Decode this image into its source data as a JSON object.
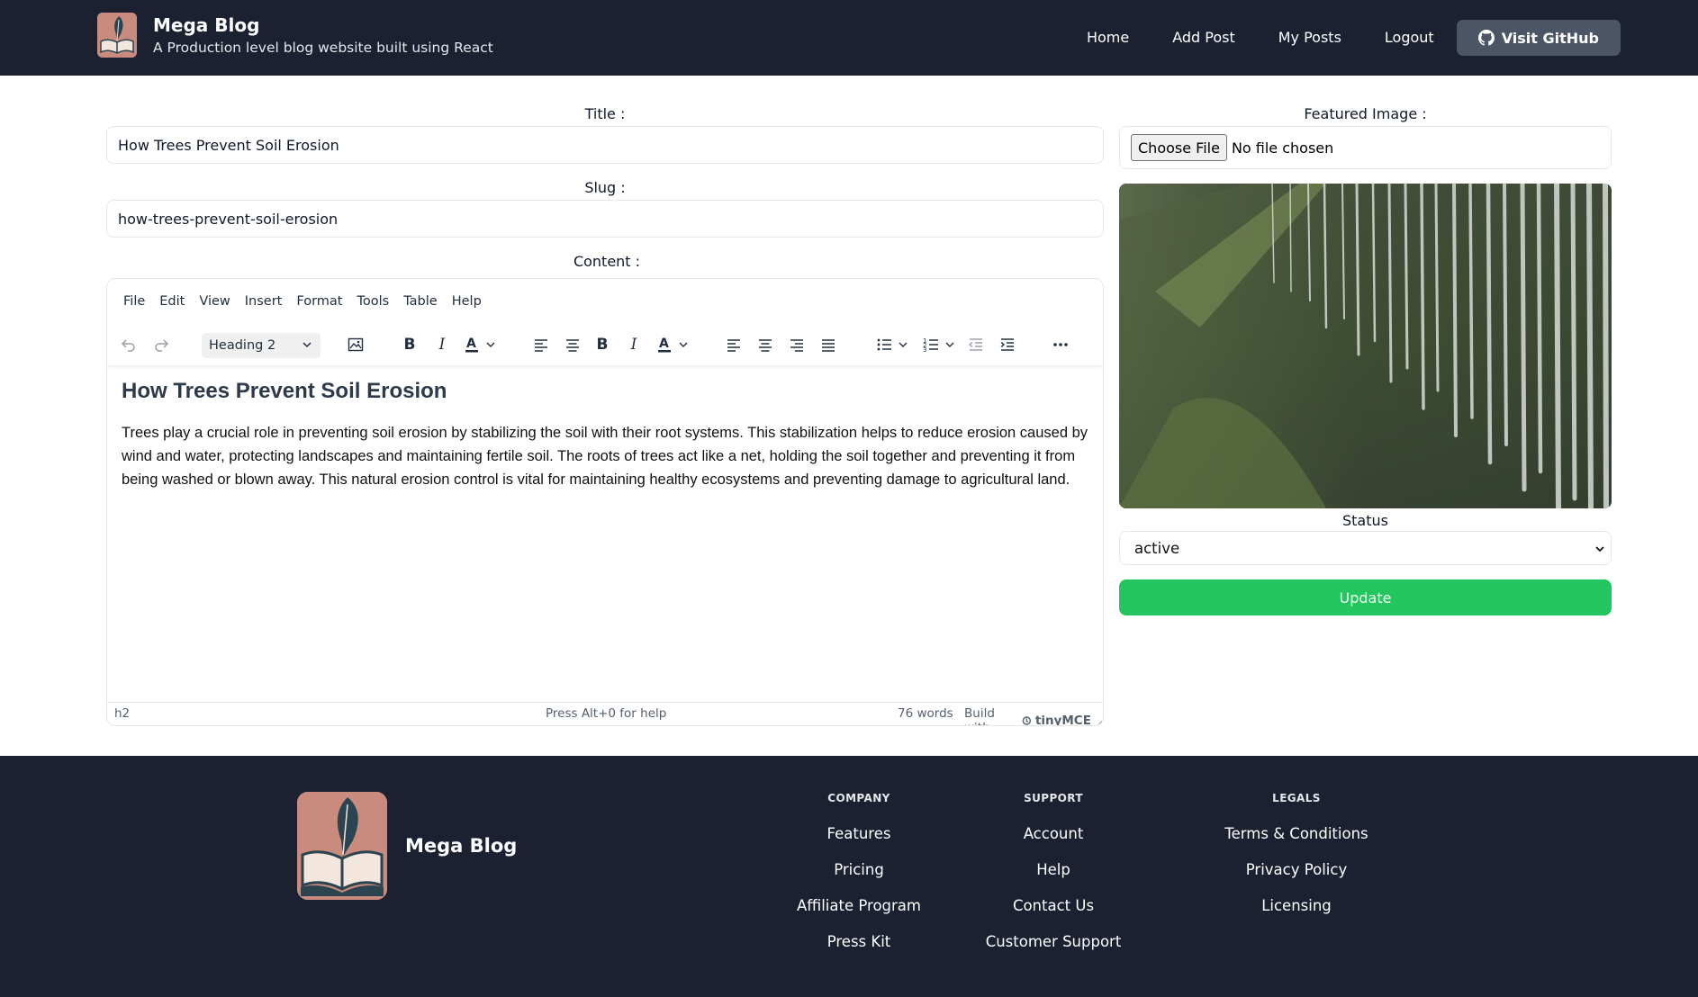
{
  "header": {
    "title": "Mega Blog",
    "subtitle": "A Production level blog website built using React",
    "nav": [
      "Home",
      "Add Post",
      "My Posts",
      "Logout"
    ],
    "github_label": "Visit GitHub"
  },
  "form": {
    "title_label": "Title :",
    "title_value": "How Trees Prevent Soil Erosion",
    "slug_label": "Slug :",
    "slug_value": "how-trees-prevent-soil-erosion",
    "content_label": "Content :",
    "featured_label": "Featured Image :",
    "choose_file": "Choose File",
    "file_status": "No file chosen",
    "status_label": "Status",
    "status_value": "active",
    "update_label": "Update"
  },
  "editor": {
    "menus": [
      "File",
      "Edit",
      "View",
      "Insert",
      "Format",
      "Tools",
      "Table",
      "Help"
    ],
    "block_format": "Heading 2",
    "heading": "How Trees Prevent Soil Erosion",
    "paragraph": "Trees play a crucial role in preventing soil erosion by stabilizing the soil with their root systems. This stabilization helps to reduce erosion caused by wind and water, protecting landscapes and maintaining fertile soil. The roots of trees act like a net, holding the soil together and preventing it from being washed or blown away. This natural erosion control is vital for maintaining healthy ecosystems and preventing damage to agricultural land.",
    "path": "h2",
    "help": "Press Alt+0 for help",
    "word_count": "76 words",
    "build_with": "Build with",
    "brand": "tinyMCE"
  },
  "footer": {
    "title": "Mega Blog",
    "columns": [
      {
        "heading": "COMPANY",
        "links": [
          "Features",
          "Pricing",
          "Affiliate Program",
          "Press Kit"
        ]
      },
      {
        "heading": "SUPPORT",
        "links": [
          "Account",
          "Help",
          "Contact Us",
          "Customer Support"
        ]
      },
      {
        "heading": "LEGALS",
        "links": [
          "Terms & Conditions",
          "Privacy Policy",
          "Licensing"
        ]
      }
    ]
  },
  "colors": {
    "header_bg": "#1b2130",
    "update_green": "#22c55e",
    "github_btn": "#4b5565",
    "logo_pink": "#c98b7d"
  }
}
